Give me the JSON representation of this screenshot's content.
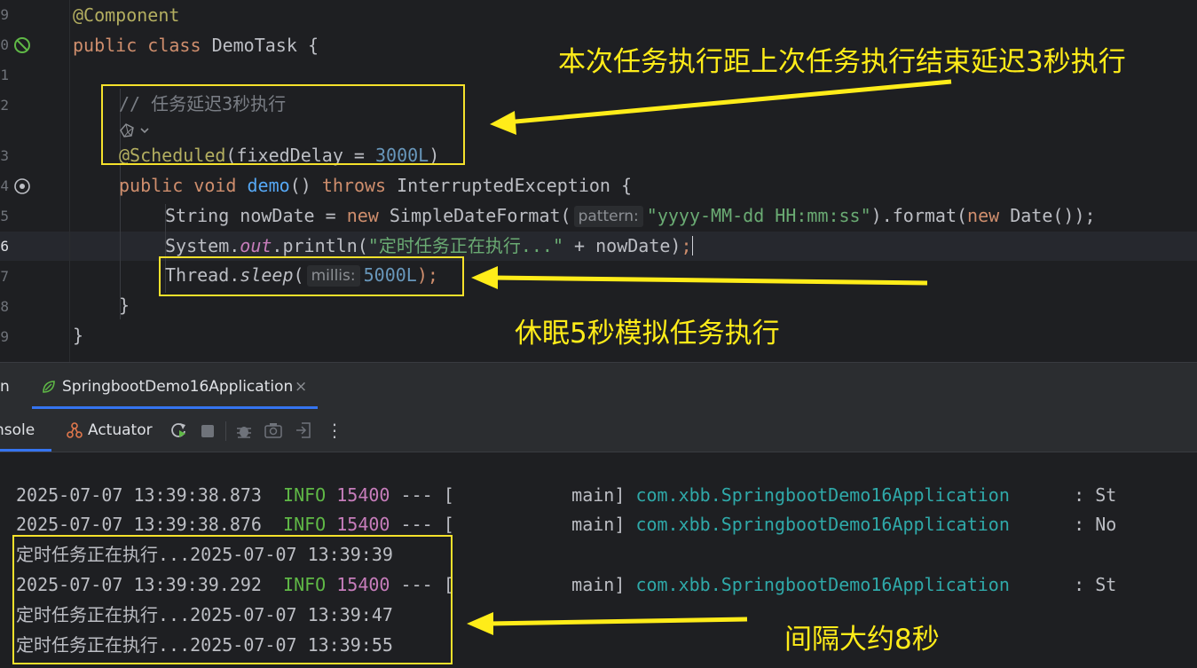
{
  "editor": {
    "line_numbers": [
      "9",
      "0",
      "1",
      "2",
      "3",
      "4",
      "5",
      "6",
      "7",
      "8",
      "9"
    ],
    "annotation_component": "@Component",
    "kw_public": "public",
    "kw_class": "class",
    "class_name": "DemoTask",
    "open_brace": "{",
    "comment": "// 任务延迟3秒执行",
    "scheduled_annotation": "@Scheduled",
    "scheduled_args_open": "(fixedDelay = ",
    "scheduled_value": "3000L",
    "scheduled_close": ")",
    "kw_void": "void",
    "method_name": "demo",
    "method_parens": "()",
    "kw_throws": "throws",
    "exception_type": "InterruptedException",
    "string_type": "String",
    "var_decl": " nowDate = ",
    "kw_new": "new",
    "sdf_type": "SimpleDateFormat(",
    "hint_pattern": "pattern:",
    "format_string": "\"yyyy-MM-dd HH:mm:ss\"",
    "format_call": ").format(",
    "date_ctor": "Date());",
    "system": "System.",
    "out": "out",
    "println_open": ".println(",
    "println_string": "\"定时任务正在执行...\"",
    "println_rest": " + nowDate)",
    "semicolon": ";",
    "thread": "Thread.",
    "sleep": "sleep",
    "paren_open": "(",
    "hint_millis": "millis:",
    "sleep_value": "5000L",
    "sleep_close": ");",
    "close_brace": "}"
  },
  "annotations": {
    "top_label": "本次任务执行距上次任务执行结束延迟3秒执行",
    "middle_label": "休眠5秒模拟任务执行",
    "bottom_label": "间隔大约8秒",
    "accent_color": "#ffec19"
  },
  "run_panel": {
    "tab_run_fragment": "n",
    "tab_app": "SpringbootDemo16Application",
    "tab_close": "×",
    "console_tab": "nsole",
    "actuator_tab": "Actuator",
    "more": "⋮"
  },
  "console": {
    "log1": {
      "ts": "2025-07-07 13:39:38.873",
      "level": "INFO",
      "pid": "15400",
      "sep": " --- [",
      "thread": "           main]",
      "logger": "com.xbb.SpringbootDemo16Application",
      "tail": "      : St"
    },
    "log2": {
      "ts": "2025-07-07 13:39:38.876",
      "level": "INFO",
      "pid": "15400",
      "sep": " --- [",
      "thread": "           main]",
      "logger": "com.xbb.SpringbootDemo16Application",
      "tail": "      : No"
    },
    "out1": "定时任务正在执行...2025-07-07 13:39:39",
    "log3": {
      "ts": "2025-07-07 13:39:39.292",
      "level": "INFO",
      "pid": "15400",
      "sep": " --- [",
      "thread": "           main]",
      "logger": "com.xbb.SpringbootDemo16Application",
      "tail": "      : St"
    },
    "out2": "定时任务正在执行...2025-07-07 13:39:47",
    "out3": "定时任务正在执行...2025-07-07 13:39:55"
  }
}
